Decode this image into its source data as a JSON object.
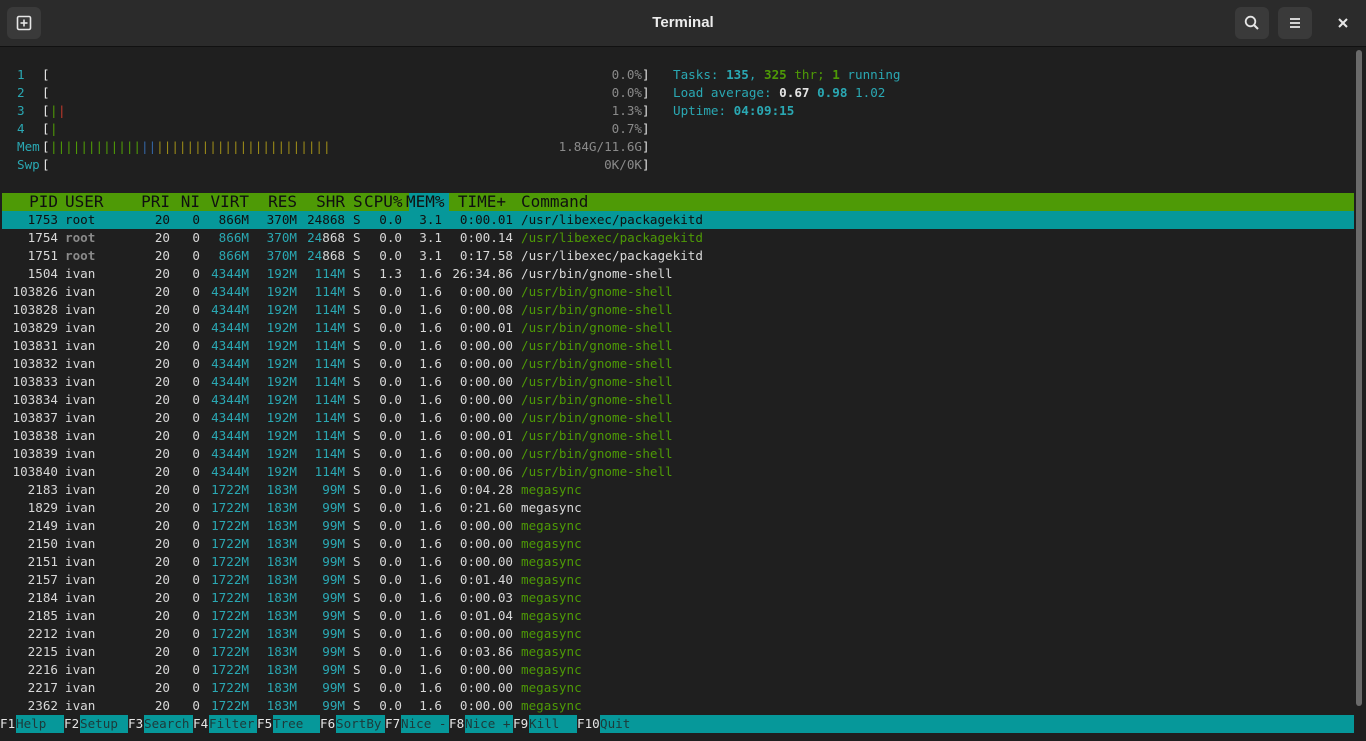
{
  "window": {
    "title": "Terminal"
  },
  "cpus": [
    {
      "label": "1",
      "pct": "0.0%"
    },
    {
      "label": "2",
      "pct": "0.0%"
    },
    {
      "label": "3",
      "pct": "1.3%"
    },
    {
      "label": "4",
      "pct": "0.7%"
    }
  ],
  "mem": {
    "label": "Mem",
    "value": "1.84G/11.6G"
  },
  "swp": {
    "label": "Swp",
    "value": "0K/0K"
  },
  "summary": {
    "tasks_label": "Tasks: ",
    "tasks": "135",
    "sep": ", ",
    "threads": "325",
    "thr_label": " thr; ",
    "running": "1",
    "running_label": " running",
    "load_label": "Load average: ",
    "load1": "0.67",
    "load5": "0.98",
    "load15": "1.02",
    "uptime_label": "Uptime: ",
    "uptime": "04:09:15"
  },
  "columns": [
    "PID",
    "USER",
    "PRI",
    "NI",
    "VIRT",
    "RES",
    "SHR",
    "S",
    "CPU%",
    "MEM%",
    "TIME+",
    "Command"
  ],
  "processes": [
    {
      "pid": "1753",
      "user": "root",
      "pri": "20",
      "ni": "0",
      "virt": "866M",
      "res": "370M",
      "shr": "24868",
      "s": "S",
      "cpu": "0.0",
      "mem": "3.1",
      "time": "0:00.01",
      "cmd": "/usr/libexec/packagekitd"
    },
    {
      "pid": "1754",
      "user": "root",
      "pri": "20",
      "ni": "0",
      "virt": "866M",
      "res": "370M",
      "shr": "24868",
      "s": "S",
      "cpu": "0.0",
      "mem": "3.1",
      "time": "0:00.14",
      "cmd": "/usr/libexec/packagekitd"
    },
    {
      "pid": "1751",
      "user": "root",
      "pri": "20",
      "ni": "0",
      "virt": "866M",
      "res": "370M",
      "shr": "24868",
      "s": "S",
      "cpu": "0.0",
      "mem": "3.1",
      "time": "0:17.58",
      "cmd": "/usr/libexec/packagekitd"
    },
    {
      "pid": "1504",
      "user": "ivan",
      "pri": "20",
      "ni": "0",
      "virt": "4344M",
      "res": "192M",
      "shr": "114M",
      "s": "S",
      "cpu": "1.3",
      "mem": "1.6",
      "time": "26:34.86",
      "cmd": "/usr/bin/gnome-shell"
    },
    {
      "pid": "103826",
      "user": "ivan",
      "pri": "20",
      "ni": "0",
      "virt": "4344M",
      "res": "192M",
      "shr": "114M",
      "s": "S",
      "cpu": "0.0",
      "mem": "1.6",
      "time": "0:00.00",
      "cmd": "/usr/bin/gnome-shell"
    },
    {
      "pid": "103828",
      "user": "ivan",
      "pri": "20",
      "ni": "0",
      "virt": "4344M",
      "res": "192M",
      "shr": "114M",
      "s": "S",
      "cpu": "0.0",
      "mem": "1.6",
      "time": "0:00.08",
      "cmd": "/usr/bin/gnome-shell"
    },
    {
      "pid": "103829",
      "user": "ivan",
      "pri": "20",
      "ni": "0",
      "virt": "4344M",
      "res": "192M",
      "shr": "114M",
      "s": "S",
      "cpu": "0.0",
      "mem": "1.6",
      "time": "0:00.01",
      "cmd": "/usr/bin/gnome-shell"
    },
    {
      "pid": "103831",
      "user": "ivan",
      "pri": "20",
      "ni": "0",
      "virt": "4344M",
      "res": "192M",
      "shr": "114M",
      "s": "S",
      "cpu": "0.0",
      "mem": "1.6",
      "time": "0:00.00",
      "cmd": "/usr/bin/gnome-shell"
    },
    {
      "pid": "103832",
      "user": "ivan",
      "pri": "20",
      "ni": "0",
      "virt": "4344M",
      "res": "192M",
      "shr": "114M",
      "s": "S",
      "cpu": "0.0",
      "mem": "1.6",
      "time": "0:00.00",
      "cmd": "/usr/bin/gnome-shell"
    },
    {
      "pid": "103833",
      "user": "ivan",
      "pri": "20",
      "ni": "0",
      "virt": "4344M",
      "res": "192M",
      "shr": "114M",
      "s": "S",
      "cpu": "0.0",
      "mem": "1.6",
      "time": "0:00.00",
      "cmd": "/usr/bin/gnome-shell"
    },
    {
      "pid": "103834",
      "user": "ivan",
      "pri": "20",
      "ni": "0",
      "virt": "4344M",
      "res": "192M",
      "shr": "114M",
      "s": "S",
      "cpu": "0.0",
      "mem": "1.6",
      "time": "0:00.00",
      "cmd": "/usr/bin/gnome-shell"
    },
    {
      "pid": "103837",
      "user": "ivan",
      "pri": "20",
      "ni": "0",
      "virt": "4344M",
      "res": "192M",
      "shr": "114M",
      "s": "S",
      "cpu": "0.0",
      "mem": "1.6",
      "time": "0:00.00",
      "cmd": "/usr/bin/gnome-shell"
    },
    {
      "pid": "103838",
      "user": "ivan",
      "pri": "20",
      "ni": "0",
      "virt": "4344M",
      "res": "192M",
      "shr": "114M",
      "s": "S",
      "cpu": "0.0",
      "mem": "1.6",
      "time": "0:00.01",
      "cmd": "/usr/bin/gnome-shell"
    },
    {
      "pid": "103839",
      "user": "ivan",
      "pri": "20",
      "ni": "0",
      "virt": "4344M",
      "res": "192M",
      "shr": "114M",
      "s": "S",
      "cpu": "0.0",
      "mem": "1.6",
      "time": "0:00.00",
      "cmd": "/usr/bin/gnome-shell"
    },
    {
      "pid": "103840",
      "user": "ivan",
      "pri": "20",
      "ni": "0",
      "virt": "4344M",
      "res": "192M",
      "shr": "114M",
      "s": "S",
      "cpu": "0.0",
      "mem": "1.6",
      "time": "0:00.06",
      "cmd": "/usr/bin/gnome-shell"
    },
    {
      "pid": "2183",
      "user": "ivan",
      "pri": "20",
      "ni": "0",
      "virt": "1722M",
      "res": "183M",
      "shr": "99M",
      "s": "S",
      "cpu": "0.0",
      "mem": "1.6",
      "time": "0:04.28",
      "cmd": "megasync"
    },
    {
      "pid": "1829",
      "user": "ivan",
      "pri": "20",
      "ni": "0",
      "virt": "1722M",
      "res": "183M",
      "shr": "99M",
      "s": "S",
      "cpu": "0.0",
      "mem": "1.6",
      "time": "0:21.60",
      "cmd": "megasync"
    },
    {
      "pid": "2149",
      "user": "ivan",
      "pri": "20",
      "ni": "0",
      "virt": "1722M",
      "res": "183M",
      "shr": "99M",
      "s": "S",
      "cpu": "0.0",
      "mem": "1.6",
      "time": "0:00.00",
      "cmd": "megasync"
    },
    {
      "pid": "2150",
      "user": "ivan",
      "pri": "20",
      "ni": "0",
      "virt": "1722M",
      "res": "183M",
      "shr": "99M",
      "s": "S",
      "cpu": "0.0",
      "mem": "1.6",
      "time": "0:00.00",
      "cmd": "megasync"
    },
    {
      "pid": "2151",
      "user": "ivan",
      "pri": "20",
      "ni": "0",
      "virt": "1722M",
      "res": "183M",
      "shr": "99M",
      "s": "S",
      "cpu": "0.0",
      "mem": "1.6",
      "time": "0:00.00",
      "cmd": "megasync"
    },
    {
      "pid": "2157",
      "user": "ivan",
      "pri": "20",
      "ni": "0",
      "virt": "1722M",
      "res": "183M",
      "shr": "99M",
      "s": "S",
      "cpu": "0.0",
      "mem": "1.6",
      "time": "0:01.40",
      "cmd": "megasync"
    },
    {
      "pid": "2184",
      "user": "ivan",
      "pri": "20",
      "ni": "0",
      "virt": "1722M",
      "res": "183M",
      "shr": "99M",
      "s": "S",
      "cpu": "0.0",
      "mem": "1.6",
      "time": "0:00.03",
      "cmd": "megasync"
    },
    {
      "pid": "2185",
      "user": "ivan",
      "pri": "20",
      "ni": "0",
      "virt": "1722M",
      "res": "183M",
      "shr": "99M",
      "s": "S",
      "cpu": "0.0",
      "mem": "1.6",
      "time": "0:01.04",
      "cmd": "megasync"
    },
    {
      "pid": "2212",
      "user": "ivan",
      "pri": "20",
      "ni": "0",
      "virt": "1722M",
      "res": "183M",
      "shr": "99M",
      "s": "S",
      "cpu": "0.0",
      "mem": "1.6",
      "time": "0:00.00",
      "cmd": "megasync"
    },
    {
      "pid": "2215",
      "user": "ivan",
      "pri": "20",
      "ni": "0",
      "virt": "1722M",
      "res": "183M",
      "shr": "99M",
      "s": "S",
      "cpu": "0.0",
      "mem": "1.6",
      "time": "0:03.86",
      "cmd": "megasync"
    },
    {
      "pid": "2216",
      "user": "ivan",
      "pri": "20",
      "ni": "0",
      "virt": "1722M",
      "res": "183M",
      "shr": "99M",
      "s": "S",
      "cpu": "0.0",
      "mem": "1.6",
      "time": "0:00.00",
      "cmd": "megasync"
    },
    {
      "pid": "2217",
      "user": "ivan",
      "pri": "20",
      "ni": "0",
      "virt": "1722M",
      "res": "183M",
      "shr": "99M",
      "s": "S",
      "cpu": "0.0",
      "mem": "1.6",
      "time": "0:00.00",
      "cmd": "megasync"
    },
    {
      "pid": "2362",
      "user": "ivan",
      "pri": "20",
      "ni": "0",
      "virt": "1722M",
      "res": "183M",
      "shr": "99M",
      "s": "S",
      "cpu": "0.0",
      "mem": "1.6",
      "time": "0:00.00",
      "cmd": "megasync"
    }
  ],
  "function_keys": [
    {
      "key": "F1",
      "label": "Help  "
    },
    {
      "key": "F2",
      "label": "Setup "
    },
    {
      "key": "F3",
      "label": "Search"
    },
    {
      "key": "F4",
      "label": "Filter"
    },
    {
      "key": "F5",
      "label": "Tree  "
    },
    {
      "key": "F6",
      "label": "SortBy"
    },
    {
      "key": "F7",
      "label": "Nice -"
    },
    {
      "key": "F8",
      "label": "Nice +"
    },
    {
      "key": "F9",
      "label": "Kill  "
    },
    {
      "key": "F10",
      "label": "Quit"
    }
  ],
  "colors": {
    "accent_teal": "#06989a",
    "header_green": "#4e9a06",
    "background": "#1f1f1f"
  },
  "icons": {
    "new_tab": "new-tab-icon",
    "search": "search-icon",
    "menu": "hamburger-menu-icon",
    "close": "close-icon"
  }
}
